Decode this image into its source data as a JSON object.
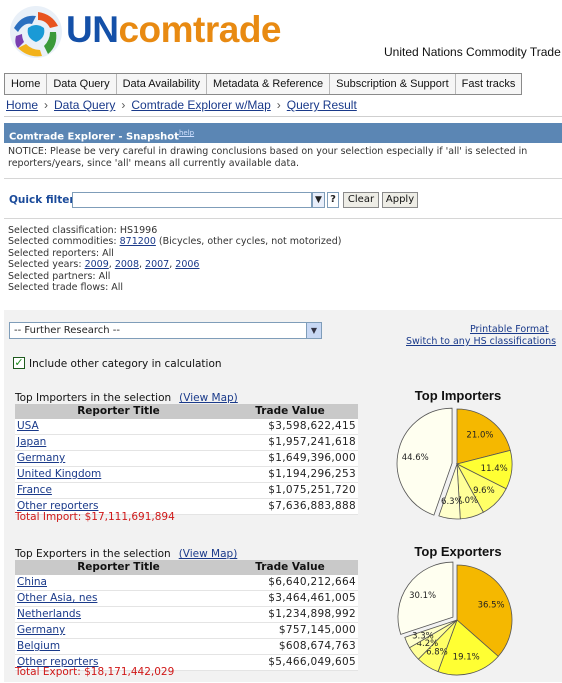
{
  "header": {
    "logo_un": "UN",
    "logo_comtrade": "comtrade",
    "org_title": "United Nations Commodity Trade S"
  },
  "nav": [
    "Home",
    "Data Query",
    "Data Availability",
    "Metadata & Reference",
    "Subscription & Support",
    "Fast tracks"
  ],
  "breadcrumb": [
    "Home",
    "Data Query",
    "Comtrade Explorer w/Map",
    "Query Result"
  ],
  "breadcrumb_sep": "›",
  "snapshot": {
    "title": "Comtrade Explorer - Snapshot",
    "help_label": "help",
    "notice": "NOTICE: Please be very careful in drawing conclusions based on your selection especially if 'all' is selected in reporters/years, since 'all' means all currently available data."
  },
  "quick_filter": {
    "label": "Quick filter",
    "value": "",
    "dropdown_glyph": "▼",
    "help_glyph": "?",
    "clear_label": "Clear",
    "apply_label": "Apply"
  },
  "selection": {
    "classification_label": "Selected classification:",
    "classification": "HS1996",
    "commodities_label": "Selected commodities:",
    "commodity_code": "871200",
    "commodity_desc": "(Bicycles, other cycles, not motorized)",
    "reporters": "Selected reporters: All",
    "years_label": "Selected years:",
    "years": [
      "2009",
      "2008",
      "2007",
      "2006"
    ],
    "partners": "Selected partners: All",
    "flows": "Selected trade flows: All"
  },
  "further_research": {
    "value": "-- Further Research --",
    "arrow": "▼",
    "printable_label": "Printable Format",
    "switch_label": "Switch to any HS classifications"
  },
  "include_other": {
    "checked": true,
    "check_glyph": "✓",
    "label": "Include other category in calculation"
  },
  "importers": {
    "section_title": "Top Importers in the selection",
    "map_link": "(View Map)",
    "col_reporter": "Reporter Title",
    "col_value": "Trade Value",
    "rows": [
      {
        "country": "USA",
        "value": "$3,598,622,415"
      },
      {
        "country": "Japan",
        "value": "$1,957,241,618"
      },
      {
        "country": "Germany",
        "value": "$1,649,396,000"
      },
      {
        "country": "United Kingdom",
        "value": "$1,194,296,253"
      },
      {
        "country": "France",
        "value": "$1,075,251,720"
      },
      {
        "country": "Other reporters",
        "value": "$7,636,883,888"
      }
    ],
    "total": "Total Import: $17,111,691,894"
  },
  "exporters": {
    "section_title": "Top Exporters in the selection",
    "map_link": "(View Map)",
    "col_reporter": "Reporter Title",
    "col_value": "Trade Value",
    "rows": [
      {
        "country": "China",
        "value": "$6,640,212,664"
      },
      {
        "country": "Other Asia, nes",
        "value": "$3,464,461,005"
      },
      {
        "country": "Netherlands",
        "value": "$1,234,898,992"
      },
      {
        "country": "Germany",
        "value": "$757,145,000"
      },
      {
        "country": "Belgium",
        "value": "$608,674,763"
      },
      {
        "country": "Other reporters",
        "value": "$5,466,049,605"
      }
    ],
    "total": "Total Export: $18,171,442,029"
  },
  "chart_data": [
    {
      "type": "pie",
      "title": "Top Importers",
      "categories": [
        "USA",
        "Japan",
        "Germany",
        "United Kingdom",
        "France",
        "Other reporters"
      ],
      "values": [
        21.0,
        11.4,
        9.6,
        7.0,
        6.3,
        44.6
      ],
      "labels": [
        "21.0%",
        "11.4%",
        "9.6%",
        "7.0%",
        "6.3%",
        "44.6%"
      ],
      "colors": [
        "#f5b800",
        "#ffff33",
        "#ffff66",
        "#ffff99",
        "#ffffcc",
        "#fffff0"
      ],
      "exploded": "Other reporters"
    },
    {
      "type": "pie",
      "title": "Top Exporters",
      "categories": [
        "China",
        "Other Asia, nes",
        "Netherlands",
        "Germany",
        "Belgium",
        "Other reporters"
      ],
      "values": [
        36.5,
        19.1,
        6.8,
        4.2,
        3.3,
        30.1
      ],
      "labels": [
        "36.5%",
        "19.1%",
        "6.8%",
        "4.2%",
        "3.3%",
        "30.1%"
      ],
      "colors": [
        "#f5b800",
        "#ffff33",
        "#ffff66",
        "#ffff99",
        "#ffffcc",
        "#fffff0"
      ],
      "exploded": "Other reporters"
    }
  ]
}
